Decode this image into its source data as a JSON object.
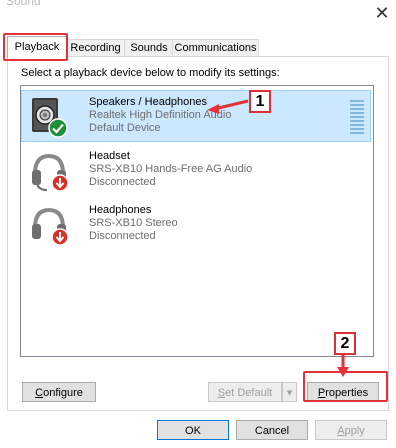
{
  "window": {
    "title": "Sound",
    "close_glyph": "✕"
  },
  "tabs": [
    {
      "label": "Playback",
      "active": true
    },
    {
      "label": "Recording",
      "active": false
    },
    {
      "label": "Sounds",
      "active": false
    },
    {
      "label": "Communications",
      "active": false
    }
  ],
  "instruction": "Select a playback device below to modify its settings:",
  "devices": [
    {
      "name": "Speakers / Headphones",
      "driver": "Realtek High Definition Audio",
      "status": "Default Device",
      "icon": "speaker-icon",
      "badge": "default-check-icon",
      "selected": true
    },
    {
      "name": "Headset",
      "driver": "SRS-XB10 Hands-Free AG Audio",
      "status": "Disconnected",
      "icon": "headset-icon",
      "badge": "disconnected-arrow-icon",
      "selected": false
    },
    {
      "name": "Headphones",
      "driver": "SRS-XB10 Stereo",
      "status": "Disconnected",
      "icon": "headphones-icon",
      "badge": "disconnected-arrow-icon",
      "selected": false
    }
  ],
  "buttons": {
    "configure": "Configure",
    "set_default": "Set Default",
    "set_default_arrow": "▾",
    "properties": "Properties",
    "ok": "OK",
    "cancel": "Cancel",
    "apply": "Apply"
  },
  "annotations": {
    "step1": "1",
    "step2": "2"
  },
  "colors": {
    "selection": "#cce8ff",
    "annotation_red": "#e3323a",
    "check_green": "#1e8f3b",
    "disconnect_red": "#d93025"
  }
}
